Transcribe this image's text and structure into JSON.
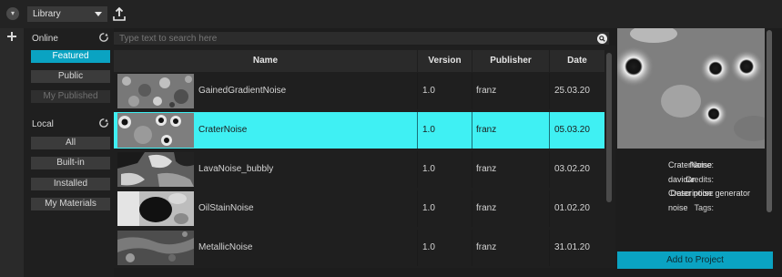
{
  "topbar": {
    "menu_icon": "chevron-down-icon",
    "library_select": "Library",
    "export_icon": "upload-icon"
  },
  "sidebar": {
    "online_label": "Online",
    "online_buttons": [
      "Featured",
      "Public",
      "My Published"
    ],
    "local_label": "Local",
    "local_buttons": [
      "All",
      "Built-in",
      "Installed",
      "My Materials"
    ],
    "active": "Featured",
    "disabled": "My Published"
  },
  "search": {
    "placeholder": "Type text to search here",
    "value": ""
  },
  "table": {
    "columns": [
      "Name",
      "Version",
      "Publisher",
      "Date"
    ],
    "rows": [
      {
        "name": "GainedGradientNoise",
        "version": "1.0",
        "publisher": "franz",
        "date": "25.03.20"
      },
      {
        "name": "CraterNoise",
        "version": "1.0",
        "publisher": "franz",
        "date": "05.03.20"
      },
      {
        "name": "LavaNoise_bubbly",
        "version": "1.0",
        "publisher": "franz",
        "date": "03.02.20"
      },
      {
        "name": "OilStainNoise",
        "version": "1.0",
        "publisher": "franz",
        "date": "01.02.20"
      },
      {
        "name": "MetallicNoise",
        "version": "1.0",
        "publisher": "franz",
        "date": "31.01.20"
      }
    ],
    "selected_index": 1
  },
  "details": {
    "name_label": "Name:",
    "name_value": "CraterNoise",
    "credits_label": "Credits:",
    "credits_value": "davidar",
    "description_label": "Description:",
    "description_value": "Crater noise generator",
    "tags_label": "Tags:",
    "tags_value": "noise",
    "add_button": "Add to Project"
  },
  "colors": {
    "accent": "#0aa3c2",
    "selection": "#3ff0f3",
    "background": "#1d1d1d"
  }
}
